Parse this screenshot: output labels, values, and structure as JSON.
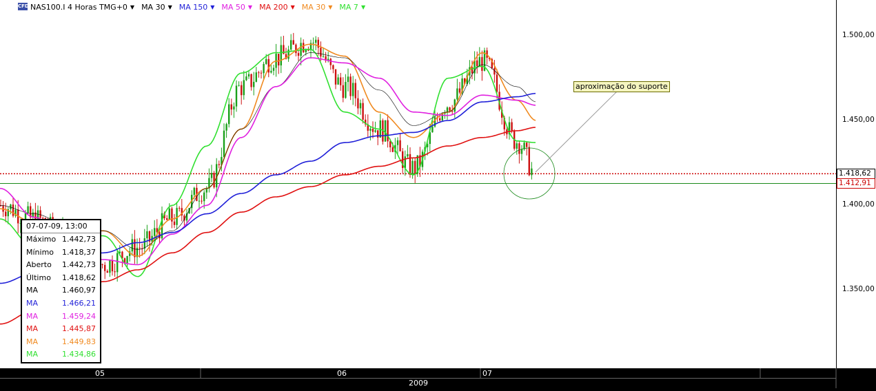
{
  "toolbar": {
    "cfd_icon": "CFD",
    "instrument": "NAS100.I 4 Horas TMG+0",
    "indicators": [
      {
        "label": "MA 30",
        "color": "#000000"
      },
      {
        "label": "MA 150",
        "color": "#1f1fd8"
      },
      {
        "label": "MA 50",
        "color": "#e020e0"
      },
      {
        "label": "MA 200",
        "color": "#e01010"
      },
      {
        "label": "MA 30",
        "color": "#f08a20"
      },
      {
        "label": "MA 7",
        "color": "#30e030"
      }
    ],
    "dropdown_icon": "triangle-down-icon"
  },
  "price_axis": {
    "ticks": [
      "1.500,00",
      "1.450,00",
      "1.400,00",
      "1.350,00"
    ],
    "tags": [
      {
        "label": "1.418,62",
        "color": "#000000",
        "bg": "#ffffff"
      },
      {
        "label": "1.412,91",
        "color": "#cc0000",
        "bg": "#ffffff"
      }
    ]
  },
  "time_axis": {
    "months": [
      "05",
      "06",
      "07"
    ],
    "year": "2009"
  },
  "info_box": {
    "header": "07-07-09, 13:00",
    "rows": [
      {
        "label": "Máximo",
        "value": "1.442,73",
        "color": "#000000"
      },
      {
        "label": "Mínimo",
        "value": "1.418,37",
        "color": "#000000"
      },
      {
        "label": "Aberto",
        "value": "1.442,73",
        "color": "#000000"
      },
      {
        "label": "Último",
        "value": "1.418,62",
        "color": "#000000"
      },
      {
        "label": "MA",
        "value": "1.460,97",
        "color": "#000000"
      },
      {
        "label": "MA",
        "value": "1.466,21",
        "color": "#1f1fd8"
      },
      {
        "label": "MA",
        "value": "1.459,24",
        "color": "#e020e0"
      },
      {
        "label": "MA",
        "value": "1.445,87",
        "color": "#e01010"
      },
      {
        "label": "MA",
        "value": "1.449,83",
        "color": "#f08a20"
      },
      {
        "label": "MA",
        "value": "1.434,86",
        "color": "#30e030"
      }
    ]
  },
  "annotation": {
    "text": "aproximação do suporte"
  },
  "chart_data": {
    "type": "line",
    "title": "NAS100.I 4 Horas TMG+0",
    "x": [
      0,
      50,
      100,
      150,
      200,
      250,
      300,
      350,
      400,
      450,
      500,
      550,
      600,
      650,
      700,
      750,
      778
    ],
    "ylim": [
      1310,
      1515
    ],
    "horizontal_levels": [
      {
        "value": 1418.62,
        "style": "dotted",
        "color": "#cc0000"
      },
      {
        "value": 1412.91,
        "style": "solid",
        "color": "#1a8a1a"
      }
    ],
    "series": [
      {
        "name": "MA 7",
        "color": "#30e030",
        "values": [
          1392,
          1375,
          1385,
          1382,
          1358,
          1400,
          1435,
          1478,
          1490,
          1492,
          1455,
          1445,
          1418,
          1475,
          1482,
          1438,
          1437
        ]
      },
      {
        "name": "MA 30",
        "color": "#f08a20",
        "values": [
          1398,
          1390,
          1383,
          1385,
          1370,
          1392,
          1410,
          1445,
          1485,
          1495,
          1488,
          1455,
          1440,
          1455,
          1490,
          1462,
          1450
        ]
      },
      {
        "name": "MA 30",
        "color": "#000000",
        "values": [
          1400,
          1395,
          1388,
          1385,
          1374,
          1385,
          1410,
          1445,
          1470,
          1490,
          1487,
          1468,
          1447,
          1455,
          1483,
          1470,
          1461
        ]
      },
      {
        "name": "MA 50",
        "color": "#e020e0",
        "values": [
          1410,
          1393,
          1378,
          1368,
          1365,
          1383,
          1400,
          1440,
          1470,
          1487,
          1484,
          1475,
          1455,
          1453,
          1465,
          1462,
          1459
        ]
      },
      {
        "name": "MA 150",
        "color": "#1f1fd8",
        "values": [
          1354,
          1360,
          1367,
          1372,
          1378,
          1384,
          1395,
          1407,
          1418,
          1426,
          1437,
          1441,
          1443,
          1450,
          1461,
          1464,
          1466
        ]
      },
      {
        "name": "MA 200",
        "color": "#e01010",
        "values": [
          1330,
          1338,
          1347,
          1355,
          1362,
          1372,
          1384,
          1396,
          1405,
          1411,
          1418,
          1423,
          1428,
          1435,
          1440,
          1444,
          1446
        ]
      }
    ],
    "candles_close": [
      1400,
      1392,
      1380,
      1365,
      1375,
      1392,
      1410,
      1470,
      1487,
      1497,
      1470,
      1445,
      1422,
      1460,
      1485,
      1438,
      1418
    ]
  }
}
